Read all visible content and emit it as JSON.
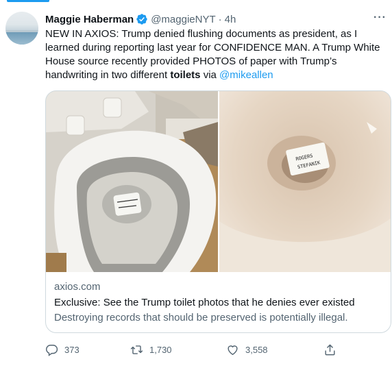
{
  "tweet": {
    "author_name": "Maggie Haberman",
    "author_handle": "@maggieNYT",
    "separator": "·",
    "time": "4h",
    "more_label": "···",
    "text": {
      "part1": "NEW IN AXIOS: Trump denied flushing documents as president, as I learned during reporting last year for CONFIDENCE MAN. A Trump White House source recently provided PHOTOS of paper with Trump’s handwriting in two different ",
      "bold": "toilets",
      "part2": " via ",
      "mention": "@mikeallen"
    }
  },
  "card": {
    "domain": "axios.com",
    "title": "Exclusive: See the Trump toilet photos that he denies ever existed",
    "description": "Destroying records that should be preserved is potentially illegal.",
    "photo_right_note_lines": [
      "ROGERS",
      "STEFANIK"
    ]
  },
  "actions": {
    "reply_count": "373",
    "retweet_count": "1,730",
    "like_count": "3,558"
  },
  "icons": {
    "verified": "verified-badge-icon",
    "reply": "reply-icon",
    "retweet": "retweet-icon",
    "like": "heart-icon",
    "share": "share-icon",
    "more": "more-icon"
  },
  "colors": {
    "accent": "#1d9bf0",
    "text": "#0f1419",
    "secondary": "#536471",
    "border": "#cfd9de"
  }
}
